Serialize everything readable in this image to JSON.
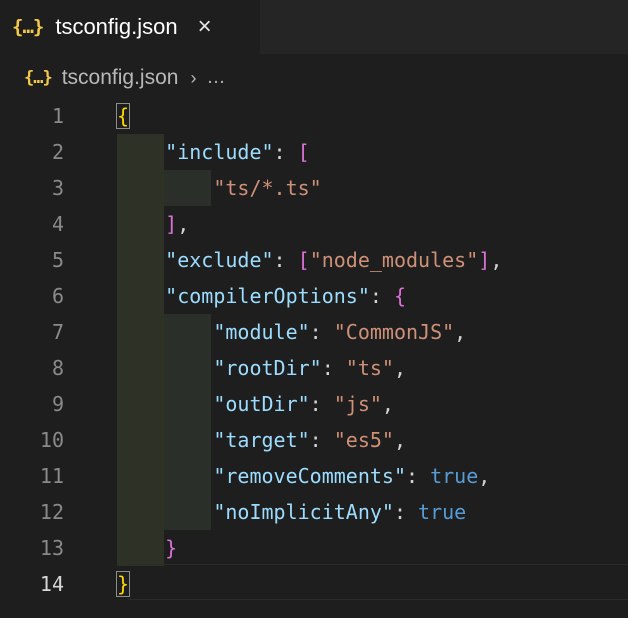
{
  "tab": {
    "icon": "{…}",
    "title": "tsconfig.json",
    "close_icon": "×"
  },
  "breadcrumb": {
    "icon": "{…}",
    "file": "tsconfig.json",
    "separator": "›",
    "more": "…"
  },
  "editor": {
    "line_numbers": [
      "1",
      "2",
      "3",
      "4",
      "5",
      "6",
      "7",
      "8",
      "9",
      "10",
      "11",
      "12",
      "13",
      "14"
    ],
    "active_line": 14,
    "lines": [
      {
        "tokens": [
          {
            "t": "{",
            "c": "y bm"
          }
        ]
      },
      {
        "tokens": [
          {
            "t": "    "
          },
          {
            "t": "\"include\"",
            "c": "k"
          },
          {
            "t": ": "
          },
          {
            "t": "[",
            "c": "p"
          }
        ]
      },
      {
        "tokens": [
          {
            "t": "        "
          },
          {
            "t": "\"ts/*.ts\"",
            "c": "s"
          }
        ]
      },
      {
        "tokens": [
          {
            "t": "    "
          },
          {
            "t": "]",
            "c": "p"
          },
          {
            "t": ","
          }
        ]
      },
      {
        "tokens": [
          {
            "t": "    "
          },
          {
            "t": "\"exclude\"",
            "c": "k"
          },
          {
            "t": ": "
          },
          {
            "t": "[",
            "c": "p"
          },
          {
            "t": "\"node_modules\"",
            "c": "s"
          },
          {
            "t": "]",
            "c": "p"
          },
          {
            "t": ","
          }
        ]
      },
      {
        "tokens": [
          {
            "t": "    "
          },
          {
            "t": "\"compilerOptions\"",
            "c": "k"
          },
          {
            "t": ": "
          },
          {
            "t": "{",
            "c": "p"
          }
        ]
      },
      {
        "tokens": [
          {
            "t": "        "
          },
          {
            "t": "\"module\"",
            "c": "k"
          },
          {
            "t": ": "
          },
          {
            "t": "\"CommonJS\"",
            "c": "s"
          },
          {
            "t": ","
          }
        ]
      },
      {
        "tokens": [
          {
            "t": "        "
          },
          {
            "t": "\"rootDir\"",
            "c": "k"
          },
          {
            "t": ": "
          },
          {
            "t": "\"ts\"",
            "c": "s"
          },
          {
            "t": ","
          }
        ]
      },
      {
        "tokens": [
          {
            "t": "        "
          },
          {
            "t": "\"outDir\"",
            "c": "k"
          },
          {
            "t": ": "
          },
          {
            "t": "\"js\"",
            "c": "s"
          },
          {
            "t": ","
          }
        ]
      },
      {
        "tokens": [
          {
            "t": "        "
          },
          {
            "t": "\"target\"",
            "c": "k"
          },
          {
            "t": ": "
          },
          {
            "t": "\"es5\"",
            "c": "s"
          },
          {
            "t": ","
          }
        ]
      },
      {
        "tokens": [
          {
            "t": "        "
          },
          {
            "t": "\"removeComments\"",
            "c": "k"
          },
          {
            "t": ": "
          },
          {
            "t": "true",
            "c": "b"
          },
          {
            "t": ","
          }
        ]
      },
      {
        "tokens": [
          {
            "t": "        "
          },
          {
            "t": "\"noImplicitAny\"",
            "c": "k"
          },
          {
            "t": ": "
          },
          {
            "t": "true",
            "c": "b"
          }
        ]
      },
      {
        "tokens": [
          {
            "t": "    "
          },
          {
            "t": "}",
            "c": "p"
          }
        ]
      },
      {
        "tokens": [
          {
            "t": "}",
            "c": "y bm"
          }
        ]
      }
    ]
  },
  "colors": {
    "background": "#1e1e1e",
    "key": "#9cdcfe",
    "string": "#ce9178",
    "boolean": "#569cd6",
    "bracket_level1": "#ffd700",
    "bracket_level2": "#da70d6",
    "indent_guide": "#2d3024"
  }
}
